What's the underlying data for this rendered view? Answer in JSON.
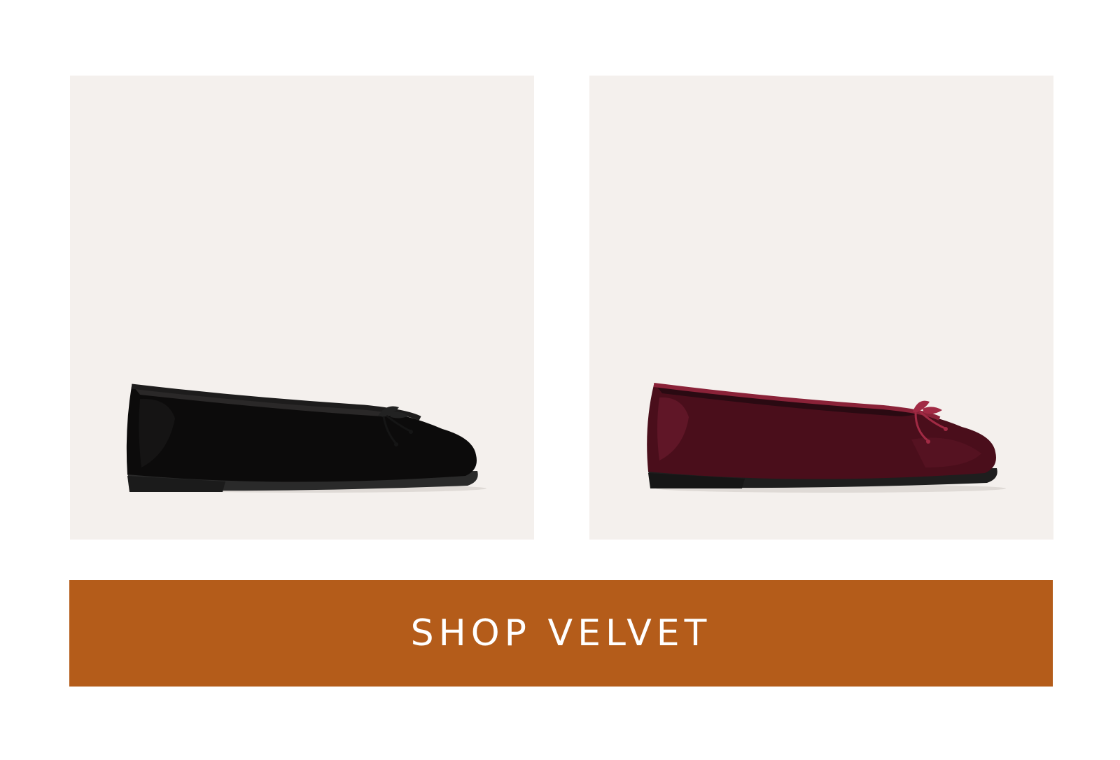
{
  "products": [
    {
      "name": "black-velvet-ballet-flat",
      "color_name": "black",
      "body_color": "#0c0b0b",
      "trim_color": "#1d1c1c",
      "sole_color": "#2a2a2a"
    },
    {
      "name": "burgundy-velvet-ballet-flat",
      "color_name": "burgundy",
      "body_color": "#4a0e1b",
      "trim_color": "#8a2238",
      "sole_color": "#1e1e1e"
    }
  ],
  "tile_background": "#f4f0ed",
  "cta": {
    "label": "SHOP VELVET",
    "background": "#b45c1a",
    "text_color": "#ffffff"
  }
}
